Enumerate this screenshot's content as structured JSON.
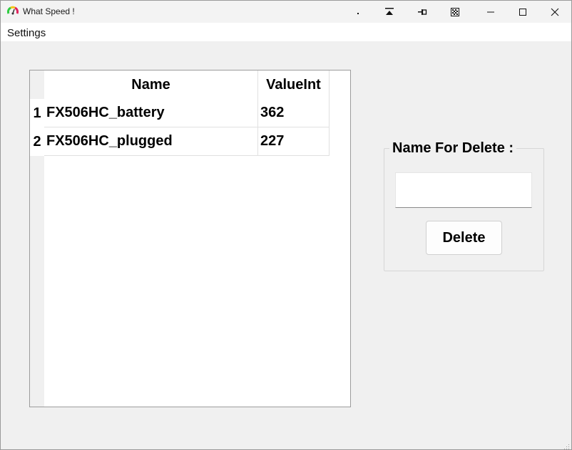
{
  "window": {
    "title": "What Speed !",
    "app_icon": "speedometer-icon",
    "titlebar_buttons": [
      "dot-icon",
      "collapse-to-top-icon",
      "pin-icon",
      "checker-icon",
      "minimize-icon",
      "maximize-icon",
      "close-icon"
    ]
  },
  "menu": {
    "items": [
      {
        "label": "Settings"
      }
    ]
  },
  "table": {
    "columns": [
      "Name",
      "ValueInt"
    ],
    "rows": [
      {
        "index": "1",
        "name": "FX506HC_battery",
        "value": "362"
      },
      {
        "index": "2",
        "name": "FX506HC_plugged",
        "value": "227"
      }
    ]
  },
  "delete_panel": {
    "title": "Name For Delete :",
    "input_value": "",
    "button_label": "Delete"
  },
  "colors": {
    "background": "#f0f0f0",
    "titlebar": "#f3f3f3",
    "table_background": "#ffffff",
    "border": "#9c9c9c"
  }
}
